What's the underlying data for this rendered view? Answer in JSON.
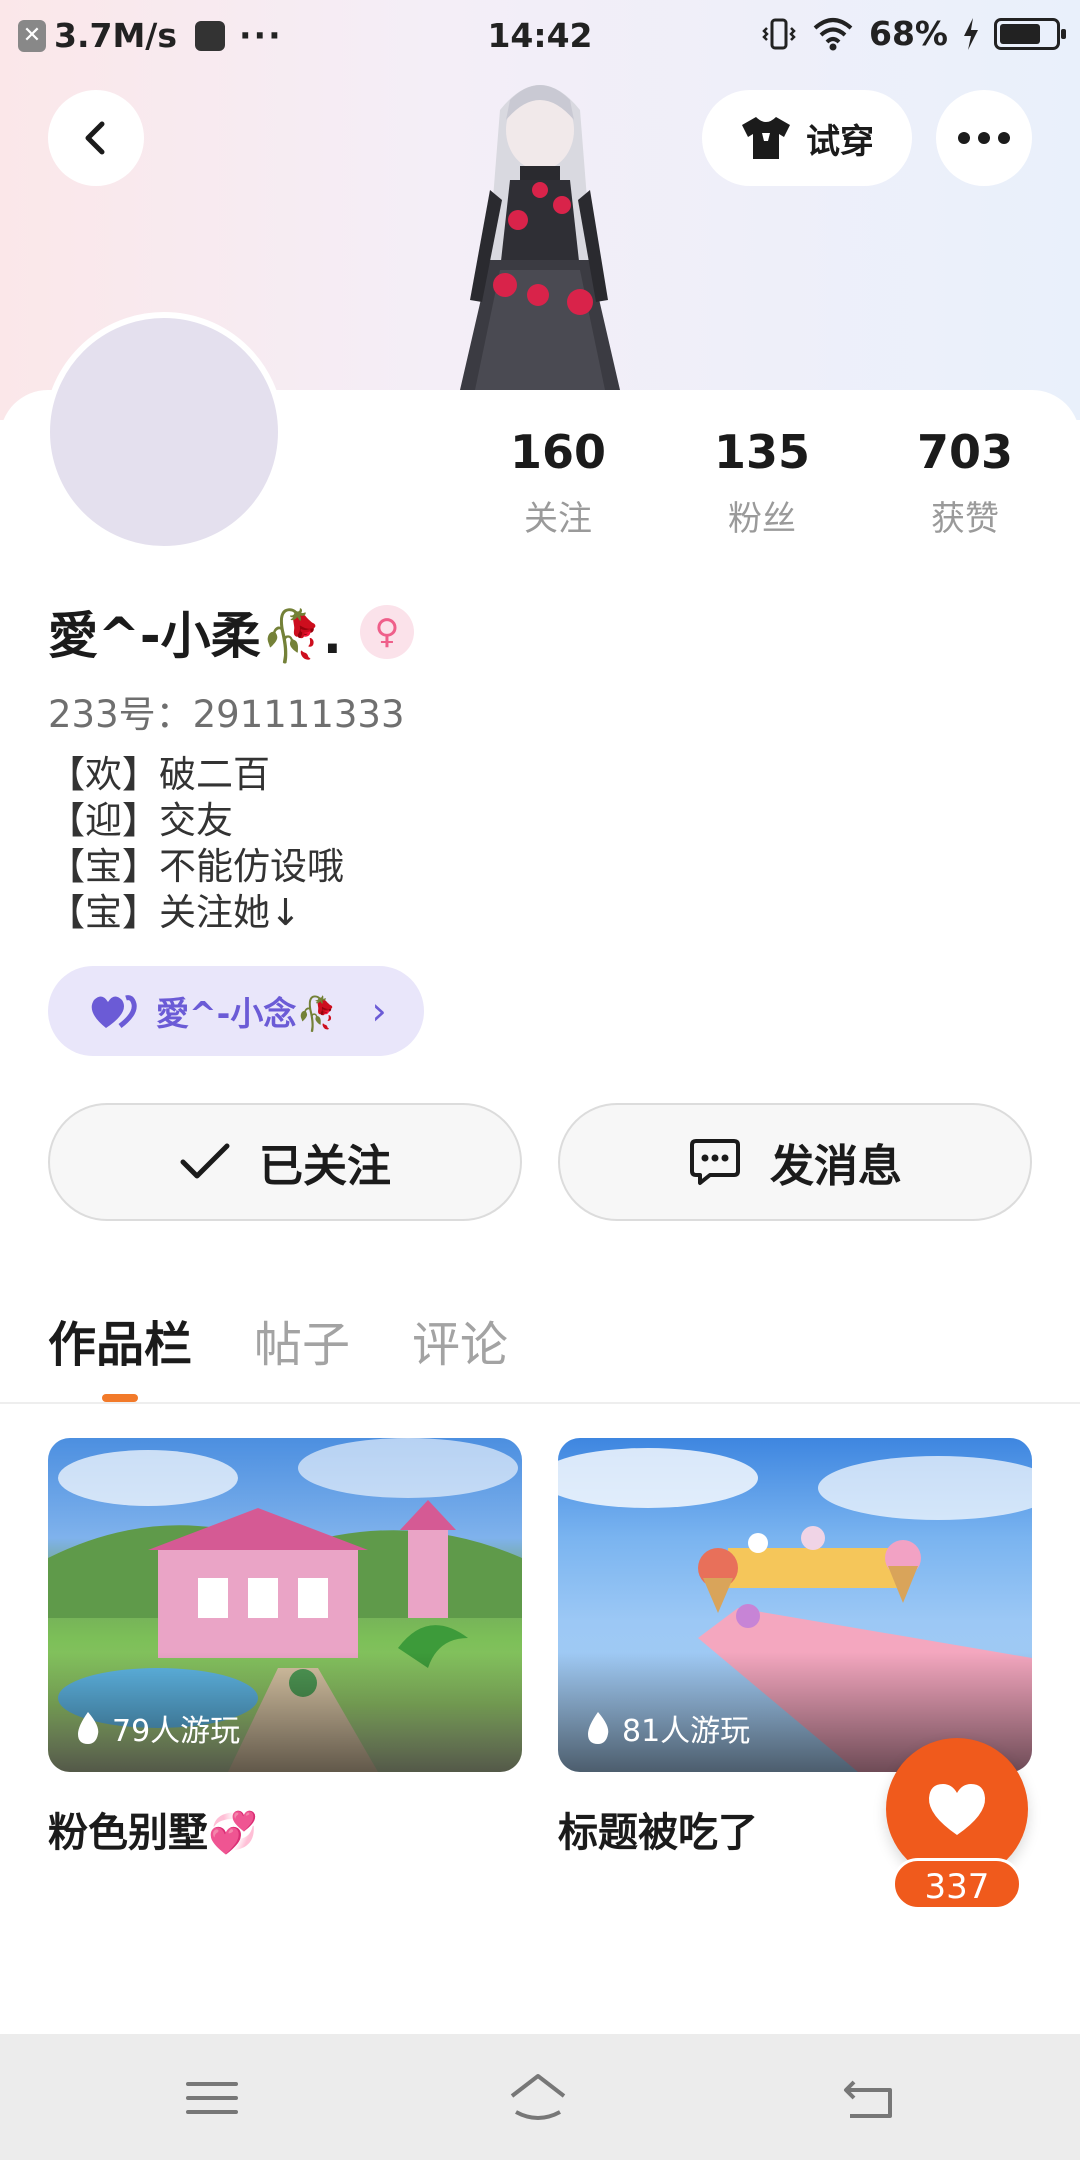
{
  "status_bar": {
    "speed": "3.7M/s",
    "dots": "···",
    "time": "14:42",
    "battery": "68%"
  },
  "header": {
    "tryon_label": "试穿"
  },
  "profile": {
    "stats": [
      {
        "value": "160",
        "label": "关注"
      },
      {
        "value": "135",
        "label": "粉丝"
      },
      {
        "value": "703",
        "label": "获赞"
      }
    ],
    "name": "愛^-小柔🥀.",
    "gender_symbol": "♀",
    "uid": "233号：291111333",
    "bio": [
      "【欢】破二百",
      "【迎】交友",
      "【宝】不能仿设哦",
      "【宝】关注她↓"
    ],
    "cp_name": "愛^-小念🥀",
    "follow_label": "已关注",
    "message_label": "发消息"
  },
  "tabs": [
    {
      "label": "作品栏",
      "active": true
    },
    {
      "label": "帖子",
      "active": false
    },
    {
      "label": "评论",
      "active": false
    }
  ],
  "works": [
    {
      "plays": "79人游玩",
      "title": "粉色别墅💞"
    },
    {
      "plays": "81人游玩",
      "title": "标题被吃了"
    }
  ],
  "like_count": "337",
  "colors": {
    "accent_orange": "#f05a1c",
    "tab_indicator": "#f27a2a",
    "cp_purple": "#6b5bd6"
  }
}
